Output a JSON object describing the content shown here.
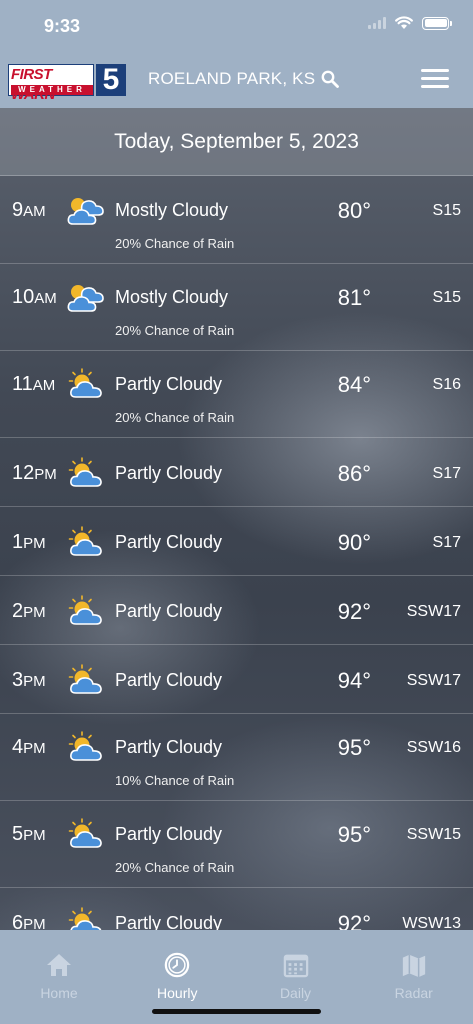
{
  "status_bar": {
    "time": "9:33"
  },
  "header": {
    "logo": {
      "line1": "FIRST WARN",
      "line2": "WEATHER",
      "number": "5"
    },
    "location": "ROELAND PARK, KS"
  },
  "date_banner": "Today, September 5, 2023",
  "hours": [
    {
      "hour": "9",
      "ampm": "AM",
      "icon": "mostly-cloudy-icon",
      "condition": "Mostly Cloudy",
      "rain": "20% Chance of Rain",
      "temp": "80°",
      "wind": "S15"
    },
    {
      "hour": "10",
      "ampm": "AM",
      "icon": "mostly-cloudy-icon",
      "condition": "Mostly Cloudy",
      "rain": "20% Chance of Rain",
      "temp": "81°",
      "wind": "S15"
    },
    {
      "hour": "11",
      "ampm": "AM",
      "icon": "partly-cloudy-icon",
      "condition": "Partly Cloudy",
      "rain": "20% Chance of Rain",
      "temp": "84°",
      "wind": "S16"
    },
    {
      "hour": "12",
      "ampm": "PM",
      "icon": "partly-cloudy-icon",
      "condition": "Partly Cloudy",
      "rain": "",
      "temp": "86°",
      "wind": "S17"
    },
    {
      "hour": "1",
      "ampm": "PM",
      "icon": "partly-cloudy-icon",
      "condition": "Partly Cloudy",
      "rain": "",
      "temp": "90°",
      "wind": "S17"
    },
    {
      "hour": "2",
      "ampm": "PM",
      "icon": "partly-cloudy-icon",
      "condition": "Partly Cloudy",
      "rain": "",
      "temp": "92°",
      "wind": "SSW17"
    },
    {
      "hour": "3",
      "ampm": "PM",
      "icon": "partly-cloudy-icon",
      "condition": "Partly Cloudy",
      "rain": "",
      "temp": "94°",
      "wind": "SSW17"
    },
    {
      "hour": "4",
      "ampm": "PM",
      "icon": "partly-cloudy-icon",
      "condition": "Partly Cloudy",
      "rain": "10% Chance of Rain",
      "temp": "95°",
      "wind": "SSW16"
    },
    {
      "hour": "5",
      "ampm": "PM",
      "icon": "partly-cloudy-icon",
      "condition": "Partly Cloudy",
      "rain": "20% Chance of Rain",
      "temp": "95°",
      "wind": "SSW15"
    },
    {
      "hour": "6",
      "ampm": "PM",
      "icon": "partly-cloudy-icon",
      "condition": "Partly Cloudy",
      "rain": "",
      "temp": "92°",
      "wind": "WSW13"
    }
  ],
  "tabs": [
    {
      "label": "Home",
      "icon": "home-icon",
      "active": false
    },
    {
      "label": "Hourly",
      "icon": "clock-icon",
      "active": true
    },
    {
      "label": "Daily",
      "icon": "calendar-icon",
      "active": false
    },
    {
      "label": "Radar",
      "icon": "map-icon",
      "active": false
    }
  ],
  "colors": {
    "header_bg": "#9fb1c5",
    "sun": "#f2b72a",
    "cloud": "#4a90d9"
  }
}
